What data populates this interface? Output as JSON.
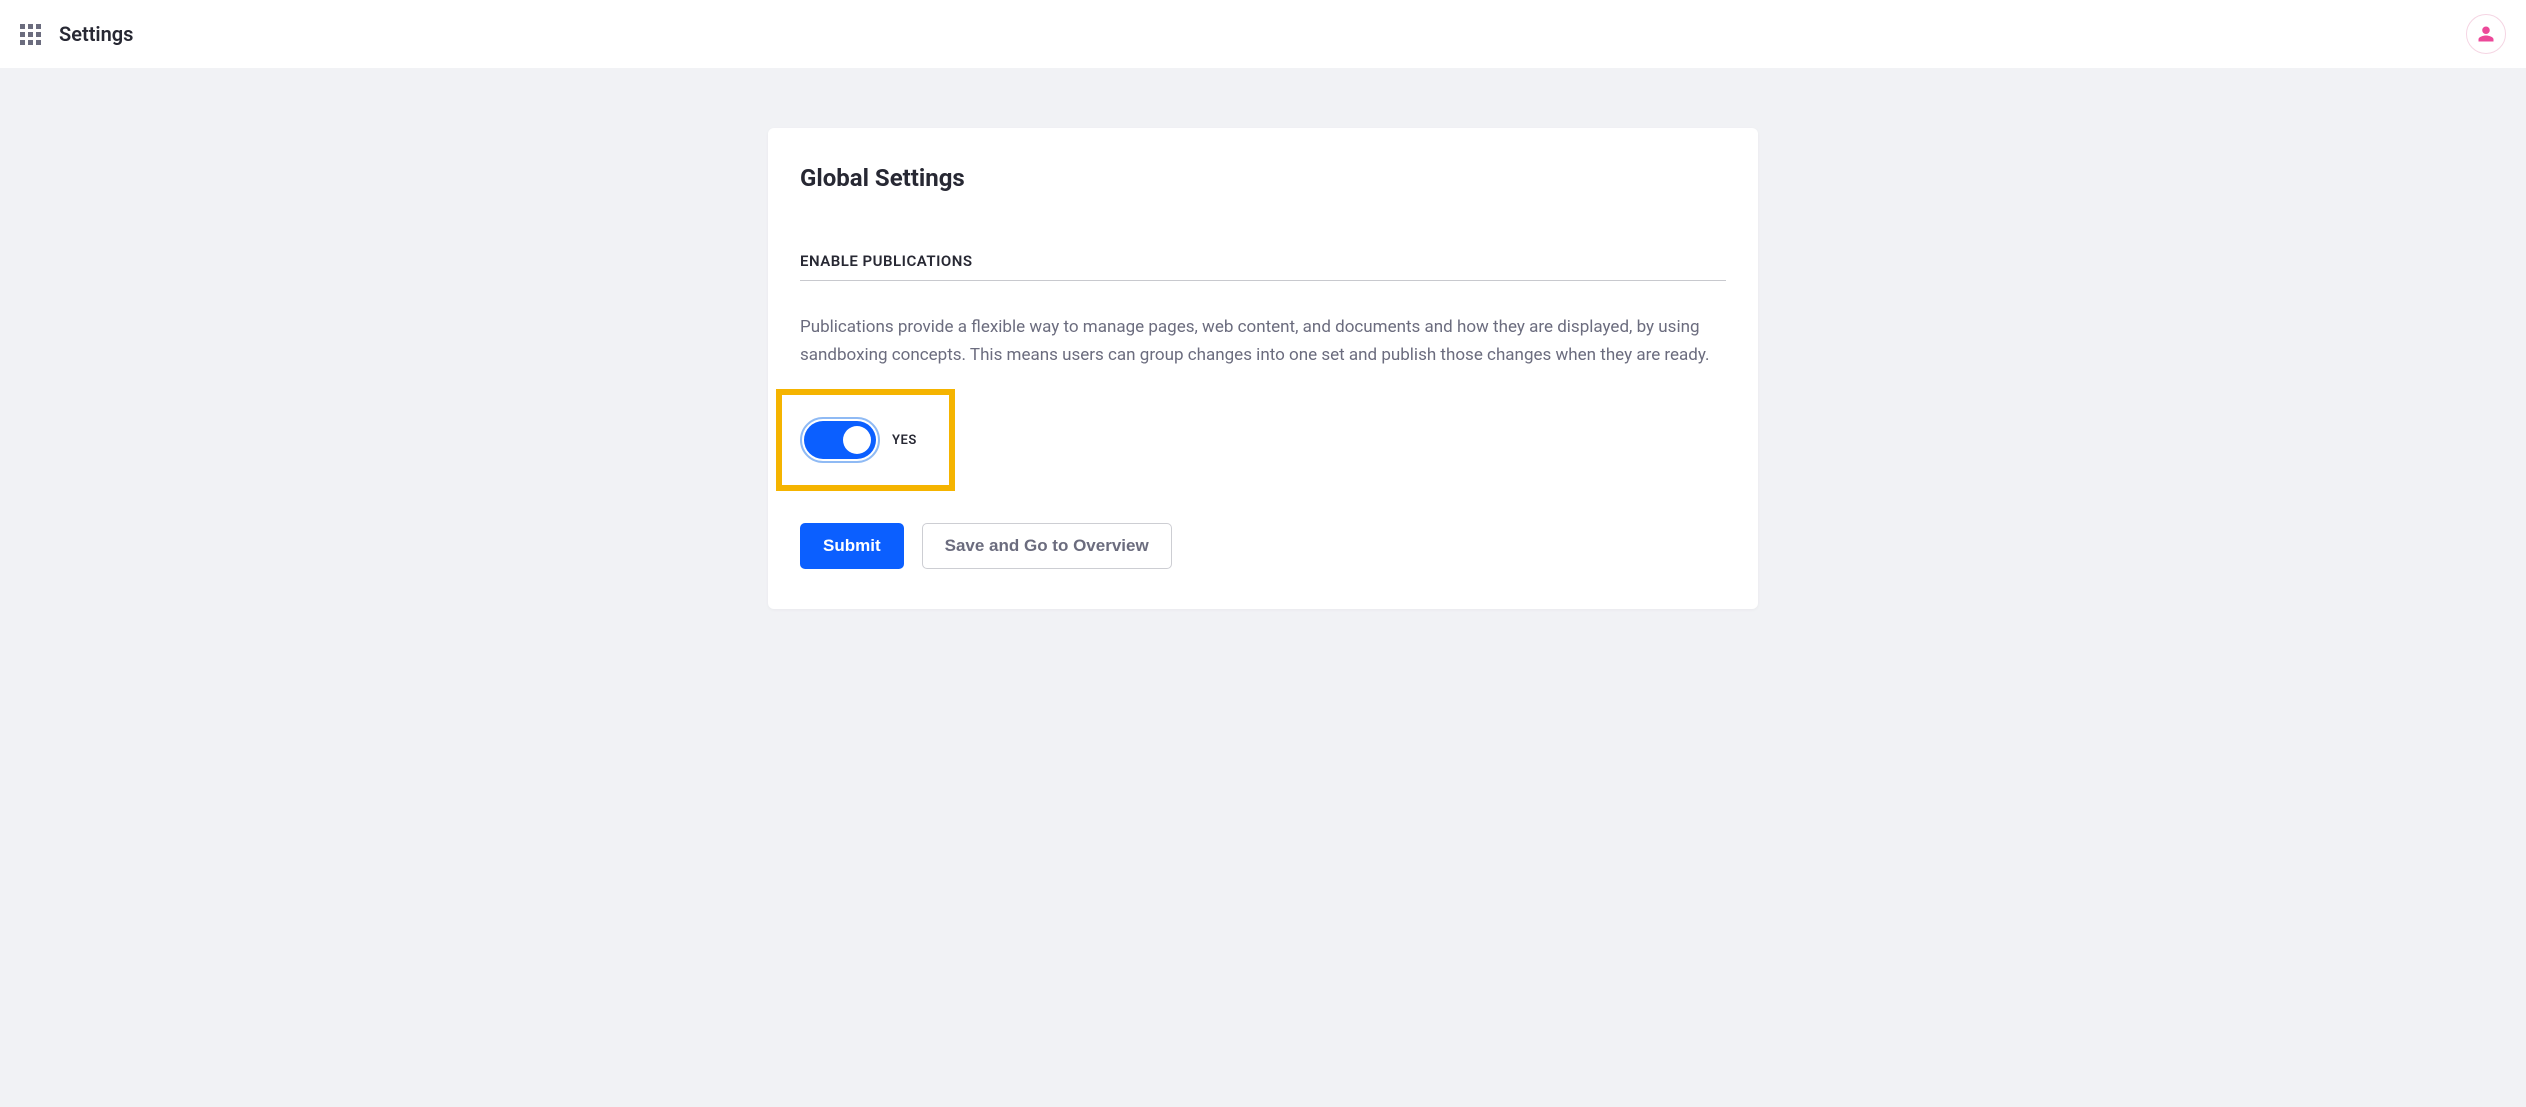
{
  "header": {
    "title": "Settings"
  },
  "card": {
    "title": "Global Settings",
    "section_header": "ENABLE PUBLICATIONS",
    "description": "Publications provide a flexible way to manage pages, web content, and documents and how they are displayed, by using sandboxing concepts. This means users can group changes into one set and publish those changes when they are ready.",
    "toggle_state": "on",
    "toggle_label": "YES"
  },
  "buttons": {
    "submit": "Submit",
    "save_overview": "Save and Go to Overview"
  }
}
